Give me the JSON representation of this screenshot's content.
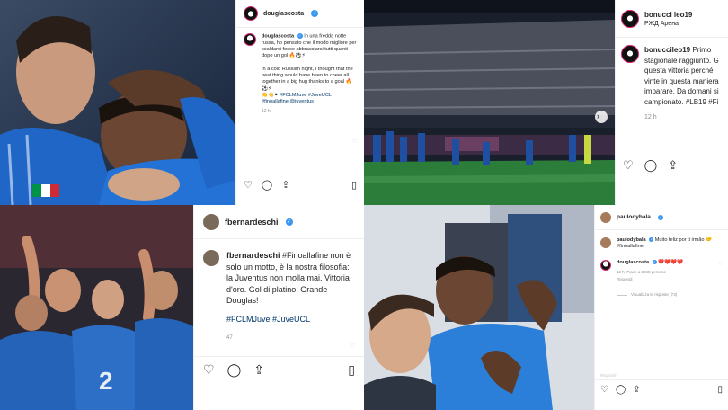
{
  "panels": {
    "top_left": {
      "account": {
        "username": "douglascosta",
        "verified_badge": "✓"
      },
      "caption": {
        "username": "douglascosta",
        "italian": "In una fredda notte russa, ho pensato che il modo migliore per scaldarsi fosse abbracciarsi tutti quanti dopo un gol 🔥⚽⚡",
        "dot": ".",
        "english": "In a cold Russian night, I thought that the best thing would have been to cheer all together in a big hug thanks to a goal 🔥⚽⚡",
        "extra": "👏👋⚫ #FCLMJuve #JuveUCL #finoallafine @juventus"
      },
      "time": "12 h"
    },
    "top_right": {
      "account": {
        "username": "bonucci leo19",
        "location": "РЖД Арена"
      },
      "caption": {
        "username": "bonuccileo19",
        "text": "Primo stagionale raggiunto. G questa vittoria perché vinte in questa maniera imparare. Da domani si campionato. #LB19 #Fi"
      },
      "time": "12 h"
    },
    "bottom_left": {
      "account": {
        "username": "fbernardeschi"
      },
      "caption": {
        "username": "fbernardeschi",
        "text": "#Finoallafine non è solo un motto, è la nostra filosofia: la Juventus non molla mai. Vittoria d'oro. Gol di platino. Grande Douglas!",
        "tags": "#FCLMJuve #JuveUCL"
      },
      "time": "47"
    },
    "bottom_right": {
      "account": {
        "username": "paulodybala"
      },
      "comments": [
        {
          "username": "paulodybala",
          "text": "Muito feliz por ti irmão 🤝 #finoallafine"
        },
        {
          "username": "douglascosta",
          "text": "❤️❤️❤️❤️",
          "time": "12 h",
          "likes": "Piace a 3968 persone",
          "reply": "Rispondi",
          "view_replies": "Visualizza le risposte (73)"
        }
      ],
      "time": "Rispondi"
    }
  },
  "icons": [
    "heart-icon",
    "comment-icon",
    "share-icon",
    "bookmark-icon",
    "chevron-right-icon"
  ],
  "colors": {
    "verified": "#3897f0",
    "tag": "#00376b",
    "juve_blue": "#1f6fcf"
  }
}
